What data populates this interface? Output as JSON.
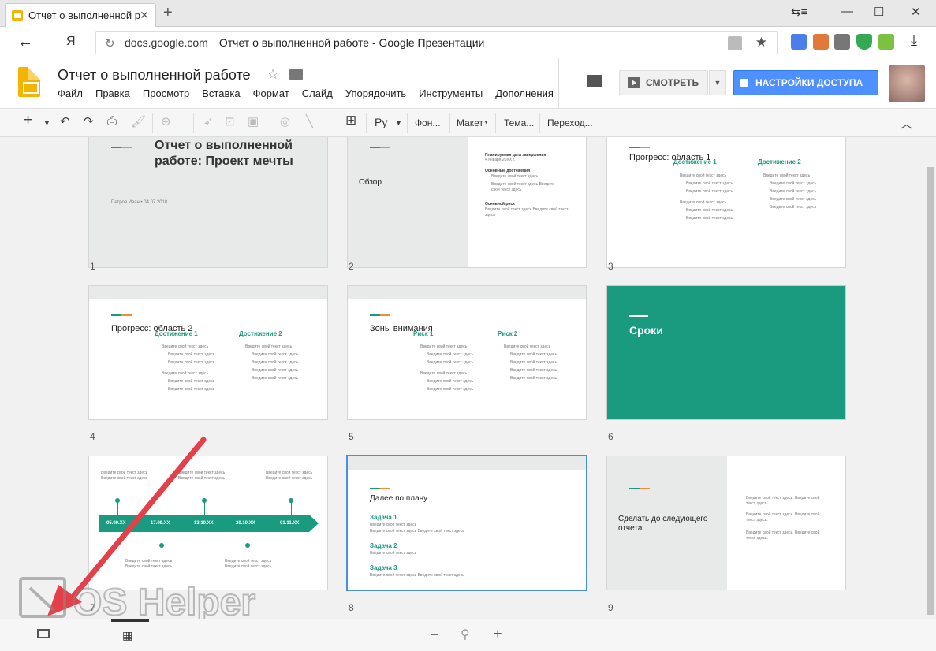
{
  "browser": {
    "tab_title": "Отчет о выполненной ра",
    "url_domain": "docs.google.com",
    "url_title": "Отчет о выполненной работе - Google Презентации",
    "yandex_label": "Я"
  },
  "app": {
    "doc_title": "Отчет о выполненной работе",
    "menu": [
      "Файл",
      "Правка",
      "Просмотр",
      "Вставка",
      "Формат",
      "Слайд",
      "Упорядочить",
      "Инструменты",
      "Дополнения"
    ],
    "watch_label": "СМОТРЕТЬ",
    "share_label": "НАСТРОЙКИ ДОСТУПА",
    "accent_color": "#1a9a7f",
    "share_color": "#4d90fe"
  },
  "toolbar": {
    "lang": "Ру",
    "background": "Фон...",
    "layout": "Макет",
    "theme": "Тема...",
    "transition": "Переход..."
  },
  "slides": {
    "s1": {
      "title": "Отчет о выполненной работе: Проект мечты",
      "meta": "Петров Иван • 04.07.2018",
      "num": "1"
    },
    "s2": {
      "title": "Обзор",
      "h1": "Планируемая дата завершения",
      "d1": "4 января 20XX г.",
      "h2": "Основные достижения",
      "b1": "Введите свой текст здесь",
      "b2": "Введите свой текст здесь Введите свой текст здесь",
      "h3": "Основной риск",
      "r1": "Введите свой текст здесь Введите свой текст здесь",
      "num": "2"
    },
    "s3": {
      "title": "Прогресс: область 1",
      "c1": "Достижение 1",
      "c2": "Достижение 2",
      "line": "Введите свой текст здесь",
      "num": "3"
    },
    "s4": {
      "title": "Прогресс: область 2",
      "c1": "Достижение 1",
      "c2": "Достижение 2",
      "line": "Введите свой текст здесь",
      "num": "4"
    },
    "s5": {
      "title": "Зоны внимания",
      "c1": "Риск 1",
      "c2": "Риск 2",
      "line": "Введите свой текст здесь",
      "num": "5"
    },
    "s6": {
      "title": "Сроки",
      "num": "6"
    },
    "s7": {
      "dates": [
        "05.09.XX",
        "17.09.XX",
        "13.10.XX",
        "20.10.XX",
        "01.11.XX"
      ],
      "line": "Введите свой текст здесь Введите свой текст здесь",
      "num": "7"
    },
    "s8": {
      "title": "Далее по плану",
      "t1": "Задача 1",
      "t2": "Задача 2",
      "t3": "Задача 3",
      "line1": "Введите свой текст здесь",
      "line2": "Введите свой текст здесь Введите свой текст здесь",
      "num": "8"
    },
    "s9": {
      "title": "Сделать до следующего отчета",
      "i1": "Введите свой текст здесь. Введите свой текст здесь.",
      "num": "9"
    }
  },
  "watermark": "OS Helper"
}
